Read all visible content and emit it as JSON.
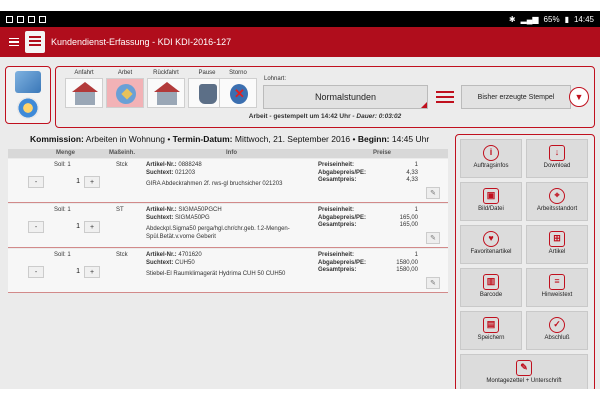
{
  "statusbar": {
    "right_text": "65%",
    "time": "14:45"
  },
  "appbar": {
    "title": "Kundendienst-Erfassung - KDI KDI-2016-127"
  },
  "toolbar": {
    "buttons": [
      {
        "label": "Anfahrt",
        "icon": "house-icon"
      },
      {
        "label": "Arbet",
        "icon": "work-icon"
      },
      {
        "label": "Rückfahrt",
        "icon": "house-icon"
      },
      {
        "label": "Pause",
        "icon": "pause-icon"
      },
      {
        "label": "Storno",
        "icon": "cancel-icon"
      }
    ],
    "lohnart_label": "Lohnart:",
    "lohnart_value": "Normalstunden",
    "stempel_label": "Bisher erzeugte Stempel",
    "gestempelt_prefix": "Arbeit - gestempelt um 14:42 Uhr - ",
    "gestempelt_dauer": "Dauer: 0:03:02"
  },
  "kommission": {
    "label": "Kommission:",
    "value": " Arbeiten in Wohnung • ",
    "termin_label": "Termin-Datum:",
    "termin_value": " Mittwoch, 21. September 2016 • ",
    "beginn_label": "Beginn:",
    "beginn_value": " 14:45 Uhr"
  },
  "table": {
    "headers": {
      "menge": "Menge",
      "masseinheit": "Maßeinh.",
      "info": "Info",
      "preise": "Preise"
    },
    "rows": [
      {
        "soll": "Soll: 1",
        "qty": "1",
        "unit": "Stck",
        "artikel_label": "Artikel-Nr.:",
        "artikel_nr": "0888248",
        "suchtext_label": "Suchtext:",
        "suchtext": "021203",
        "description": "GIRA Abdeckrahmen 2f. rws-gl bruchsicher 021203",
        "preiseinheit_label": "Preiseinheit:",
        "preiseinheit": "1",
        "abgabepreis_label": "Abgabepreis/PE:",
        "abgabepreis": "4,33",
        "gesamtpreis_label": "Gesamtpreis:",
        "gesamtpreis": "4,33"
      },
      {
        "soll": "Soll: 1",
        "qty": "1",
        "unit": "ST",
        "artikel_label": "Artikel-Nr.:",
        "artikel_nr": "SIGMA50PGCH",
        "suchtext_label": "Suchtext:",
        "suchtext": "SIGMA50PG",
        "description": "Abdeckpl.Sigma50 perga/hgl.chr/chr.geb. f.2-Mengen-Spül.Betät.v.vorne Geberit",
        "preiseinheit_label": "Preiseinheit:",
        "preiseinheit": "1",
        "abgabepreis_label": "Abgabepreis/PE:",
        "abgabepreis": "165,00",
        "gesamtpreis_label": "Gesamtpreis:",
        "gesamtpreis": "165,00"
      },
      {
        "soll": "Soll: 1",
        "qty": "1",
        "unit": "Stck",
        "artikel_label": "Artikel-Nr.:",
        "artikel_nr": "4701620",
        "suchtext_label": "Suchtext:",
        "suchtext": "CUH50",
        "description": "Stiebel-El Raumklimagerät Hydrima CUH 50 CUH50",
        "preiseinheit_label": "Preiseinheit:",
        "preiseinheit": "1",
        "abgabepreis_label": "Abgabepreis/PE:",
        "abgabepreis": "1580,00",
        "gesamtpreis_label": "Gesamtpreis:",
        "gesamtpreis": "1580,00"
      }
    ],
    "minus": "-",
    "plus": "+"
  },
  "right_panel": {
    "buttons": [
      {
        "label": "Auftragsinfos",
        "icon": "info-icon",
        "glyph": "i"
      },
      {
        "label": "Download",
        "icon": "download-icon",
        "glyph": "↓"
      },
      {
        "label": "Bild/Datei",
        "icon": "camera-icon",
        "glyph": "▣"
      },
      {
        "label": "Arbeitsstandort",
        "icon": "location-icon",
        "glyph": "⌖"
      },
      {
        "label": "Favoritenartikel",
        "icon": "favorite-icon",
        "glyph": "♥"
      },
      {
        "label": "Artikel",
        "icon": "basket-icon",
        "glyph": "⊞"
      },
      {
        "label": "Barcode",
        "icon": "barcode-icon",
        "glyph": "▥"
      },
      {
        "label": "Hinweistext",
        "icon": "note-icon",
        "glyph": "≡"
      },
      {
        "label": "Speichern",
        "icon": "save-icon",
        "glyph": "▤"
      },
      {
        "label": "Abschluß",
        "icon": "check-icon",
        "glyph": "✓"
      },
      {
        "label": "Montagezettel + Unterschrift",
        "icon": "signature-icon",
        "glyph": "✎"
      }
    ]
  }
}
